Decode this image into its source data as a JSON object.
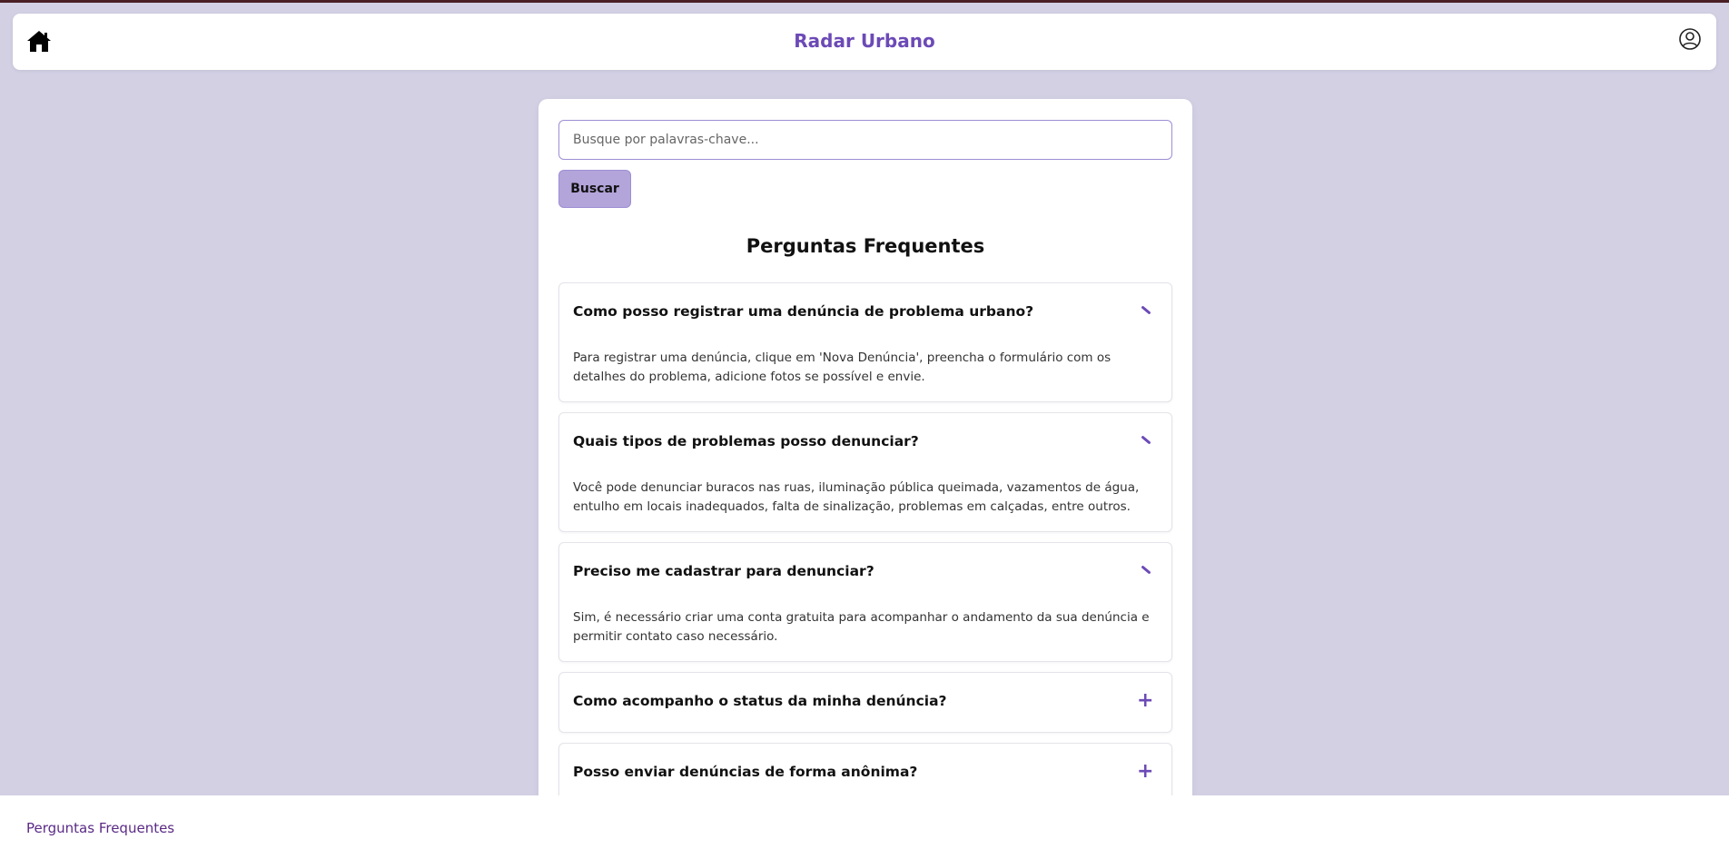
{
  "navbar": {
    "title": "Radar Urbano",
    "home_icon": "home-icon",
    "profile_icon": "user-circle-icon"
  },
  "search": {
    "placeholder": "Busque por palavras-chave...",
    "value": "",
    "button_label": "Buscar"
  },
  "faq": {
    "title": "Perguntas Frequentes",
    "items": [
      {
        "question": "Como posso registrar uma denúncia de problema urbano?",
        "answer": "Para registrar uma denúncia, clique em 'Nova Denúncia', preencha o formulário com os detalhes do problema, adicione fotos se possível e envie.",
        "expanded": true
      },
      {
        "question": "Quais tipos de problemas posso denunciar?",
        "answer": "Você pode denunciar buracos nas ruas, iluminação pública queimada, vazamentos de água, entulho em locais inadequados, falta de sinalização, problemas em calçadas, entre outros.",
        "expanded": true
      },
      {
        "question": "Preciso me cadastrar para denunciar?",
        "answer": "Sim, é necessário criar uma conta gratuita para acompanhar o andamento da sua denúncia e permitir contato caso necessário.",
        "expanded": true
      },
      {
        "question": "Como acompanho o status da minha denúncia?",
        "toggle": "+",
        "expanded": false
      },
      {
        "question": "Posso enviar denúncias de forma anônima?",
        "toggle": "+",
        "expanded": false
      }
    ]
  },
  "footer": {
    "link_label": "Perguntas Frequentes"
  },
  "colors": {
    "background": "#d3d0e4",
    "accent": "#6c4ab6",
    "button": "#b3a4da"
  }
}
